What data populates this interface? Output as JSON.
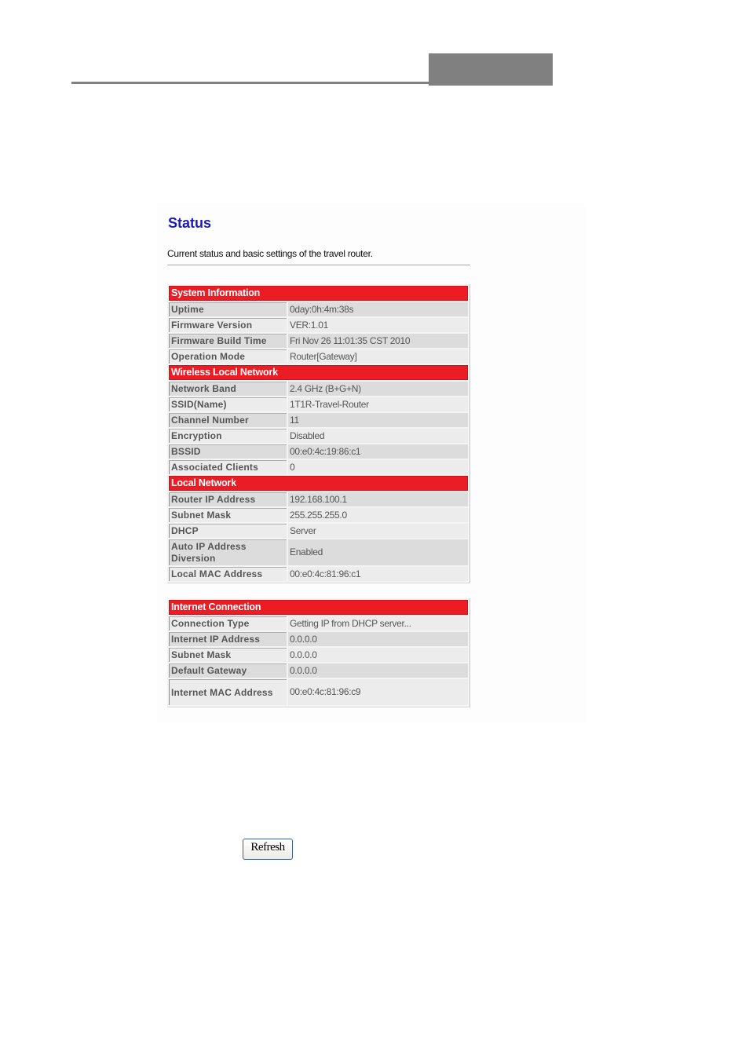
{
  "page": {
    "title": "Status",
    "description": "Current status and basic settings of the travel router.",
    "refresh_label": "Refresh"
  },
  "sections": [
    {
      "heading": "System Information",
      "rows": [
        {
          "label": "Uptime",
          "value": "0day:0h:4m:38s"
        },
        {
          "label": "Firmware Version",
          "value": "VER:1.01"
        },
        {
          "label": "Firmware Build Time",
          "value": "Fri Nov 26 11:01:35 CST 2010"
        },
        {
          "label": "Operation Mode",
          "value": "Router[Gateway]"
        }
      ]
    },
    {
      "heading": "Wireless Local Network",
      "rows": [
        {
          "label": "Network Band",
          "value": "2.4 GHz (B+G+N)"
        },
        {
          "label": "SSID(Name)",
          "value": "1T1R-Travel-Router"
        },
        {
          "label": "Channel Number",
          "value": "11"
        },
        {
          "label": "Encryption",
          "value": "Disabled"
        },
        {
          "label": "BSSID",
          "value": "00:e0:4c:19:86:c1"
        },
        {
          "label": "Associated Clients",
          "value": "0"
        }
      ]
    },
    {
      "heading": "Local Network",
      "rows": [
        {
          "label": "Router IP Address",
          "value": "192.168.100.1"
        },
        {
          "label": "Subnet Mask",
          "value": "255.255.255.0"
        },
        {
          "label": "DHCP",
          "value": "Server"
        },
        {
          "label": "Auto IP Address Diversion",
          "value": "Enabled"
        },
        {
          "label": "Local MAC Address",
          "value": "00:e0:4c:81:96:c1"
        }
      ]
    },
    {
      "heading": "Internet Connection",
      "rows": [
        {
          "label": "Connection Type",
          "value": "Getting IP from DHCP server..."
        },
        {
          "label": "Internet IP Address",
          "value": "0.0.0.0"
        },
        {
          "label": "Subnet Mask",
          "value": "0.0.0.0"
        },
        {
          "label": "Default Gateway",
          "value": "0.0.0.0"
        },
        {
          "label": "Internet MAC Address",
          "value": "00:e0:4c:81:96:c9"
        }
      ]
    }
  ],
  "colors": {
    "section_header": "#ec1c24",
    "title": "#1a1ab8",
    "header_bar": "#808080"
  }
}
